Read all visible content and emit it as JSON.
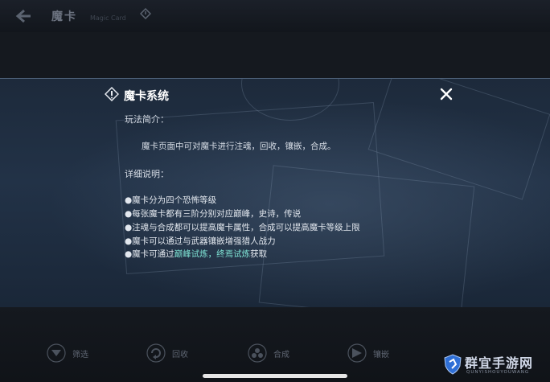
{
  "header": {
    "title": "魔卡",
    "subtitle": "Magic Card"
  },
  "dialog": {
    "title": "魔卡系统",
    "intro_heading": "玩法简介：",
    "intro_text": "魔卡页面中可对魔卡进行注魂，回收，镶嵌，合成。",
    "detail_heading": "详细说明：",
    "details": [
      "●魔卡分为四个恐怖等级",
      "●每张魔卡都有三阶分别对应巅峰，史诗，传说",
      "●注魂与合成都可以提高魔卡属性，合成可以提高魔卡等级上限",
      "●魔卡可以通过与武器镶嵌增强猎人战力"
    ],
    "last_line": {
      "prefix": "●魔卡可通过",
      "highlight": "巅峰试炼，终焉试炼",
      "suffix": "获取"
    }
  },
  "bottom_buttons": [
    {
      "label": "筛选",
      "icon": "filter-icon"
    },
    {
      "label": "回收",
      "icon": "recycle-icon"
    },
    {
      "label": "合成",
      "icon": "compose-icon"
    },
    {
      "label": "镶嵌",
      "icon": "inlay-icon"
    }
  ],
  "watermark": {
    "text": "群宜手游网",
    "sub": "QUNYISHOUYOUWANG"
  },
  "colors": {
    "highlight": "#7fe3d4",
    "panel_bg": "#223247"
  }
}
